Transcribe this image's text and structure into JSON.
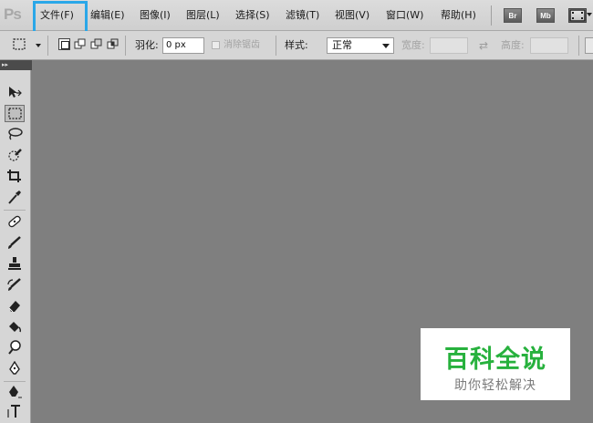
{
  "app": {
    "logo_text": "Ps"
  },
  "menu": {
    "items": [
      {
        "label": "文件(F)"
      },
      {
        "label": "编辑(E)"
      },
      {
        "label": "图像(I)"
      },
      {
        "label": "图层(L)"
      },
      {
        "label": "选择(S)"
      },
      {
        "label": "滤镜(T)"
      },
      {
        "label": "视图(V)"
      },
      {
        "label": "窗口(W)"
      },
      {
        "label": "帮助(H)"
      }
    ],
    "highlight_color": "#2aa7e8",
    "bridge_button": "Br",
    "minibridge_button": "Mb"
  },
  "options": {
    "feather_label": "羽化:",
    "feather_value": "0 px",
    "antialias_label": "消除锯齿",
    "style_label": "样式:",
    "style_value": "正常",
    "width_label": "宽度:",
    "height_label": "高度:"
  },
  "tools": {
    "header": "▸▸"
  },
  "watermark": {
    "title": "百科全说",
    "subtitle": "助你轻松解决",
    "title_color": "#27b13d"
  },
  "canvas": {
    "background": "#7f7f7f"
  }
}
